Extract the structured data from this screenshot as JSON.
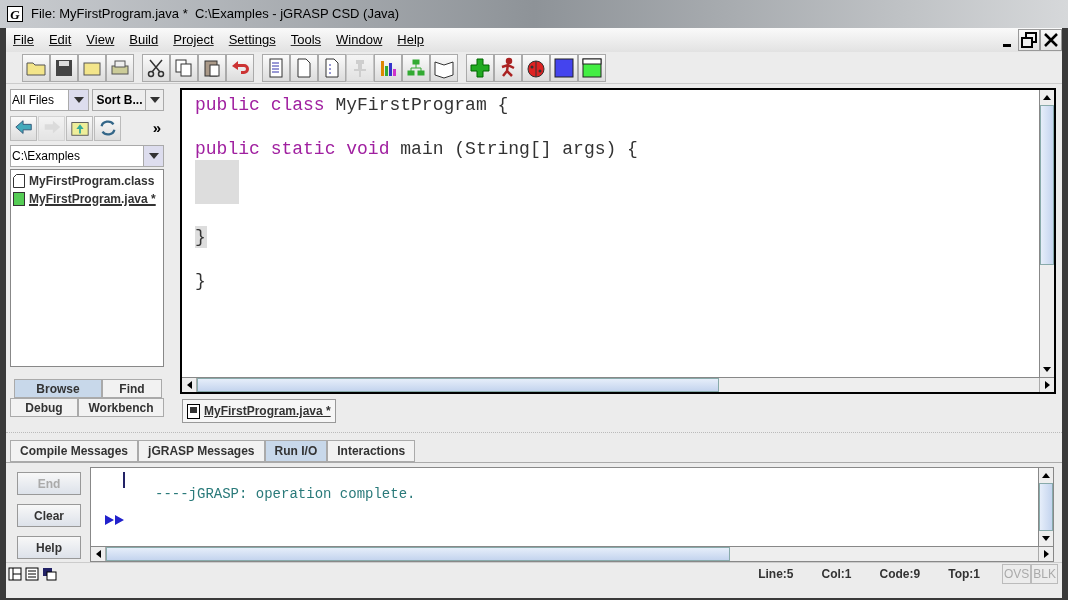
{
  "window": {
    "icon_letter": "G",
    "title": "File: MyFirstProgram.java *  C:\\Examples - jGRASP CSD (Java)"
  },
  "menu": [
    "File",
    "Edit",
    "View",
    "Build",
    "Project",
    "Settings",
    "Tools",
    "Window",
    "Help"
  ],
  "toolbar": [
    [
      {
        "kind": "open",
        "disabled": false
      },
      {
        "kind": "save",
        "disabled": false
      },
      {
        "kind": "browse",
        "disabled": false
      },
      {
        "kind": "print",
        "disabled": false
      }
    ],
    [
      {
        "kind": "cut",
        "disabled": false
      },
      {
        "kind": "copy",
        "disabled": false
      },
      {
        "kind": "paste",
        "disabled": false
      },
      {
        "kind": "undo",
        "disabled": false
      }
    ],
    [
      {
        "kind": "csd",
        "disabled": false
      },
      {
        "kind": "page",
        "disabled": false
      },
      {
        "kind": "numbers",
        "disabled": false
      },
      {
        "kind": "pin",
        "disabled": true
      },
      {
        "kind": "bars",
        "disabled": false
      },
      {
        "kind": "tree",
        "disabled": false
      },
      {
        "kind": "book",
        "disabled": false
      }
    ],
    [
      {
        "kind": "compile",
        "disabled": false
      },
      {
        "kind": "run",
        "disabled": false
      },
      {
        "kind": "debug",
        "disabled": false
      },
      {
        "kind": "square",
        "disabled": false
      },
      {
        "kind": "frame",
        "disabled": false
      }
    ]
  ],
  "browser": {
    "filter": "All Files",
    "sort": "Sort B...",
    "more": "»",
    "nav": [
      {
        "kind": "back",
        "disabled": false
      },
      {
        "kind": "forward",
        "disabled": true
      },
      {
        "kind": "up",
        "disabled": false
      },
      {
        "kind": "refresh",
        "disabled": false
      }
    ],
    "path": "C:\\Examples",
    "files": [
      {
        "name": "MyFirstProgram.class",
        "kind": "class",
        "open": false
      },
      {
        "name": "MyFirstProgram.java *",
        "kind": "java",
        "open": true
      }
    ],
    "tabs": [
      [
        {
          "label": "Browse",
          "selected": true
        },
        {
          "label": "Find",
          "selected": false
        }
      ],
      [
        {
          "label": "Debug",
          "selected": false
        },
        {
          "label": "Workbench",
          "selected": false
        }
      ]
    ]
  },
  "editor": {
    "lines": [
      {
        "highlighted": false,
        "tokens": [
          {
            "text": "public",
            "kind": "keyword"
          },
          {
            "text": "class",
            "kind": "keyword"
          },
          {
            "text": "MyFirstProgram {"
          }
        ]
      },
      {
        "highlighted": false
      },
      {
        "highlighted": false,
        "tokens": [
          {
            "text": "public",
            "kind": "keyword"
          },
          {
            "text": "static",
            "kind": "keyword"
          },
          {
            "text": "void",
            "kind": "keyword"
          },
          {
            "text": "main (String[] args) {"
          }
        ]
      },
      {
        "highlighted": true
      },
      {
        "highlighted": true
      },
      {
        "highlighted": false
      },
      {
        "highlighted": true,
        "tokens": [
          {
            "text": "}"
          }
        ]
      },
      {
        "highlighted": false
      },
      {
        "highlighted": false,
        "tokens": [
          {
            "text": "}"
          }
        ]
      }
    ],
    "file_tab": "MyFirstProgram.java *"
  },
  "messages": {
    "tabs": [
      {
        "label": "Compile Messages",
        "selected": false
      },
      {
        "label": "jGRASP Messages",
        "selected": false
      },
      {
        "label": "Run I/O",
        "selected": true
      },
      {
        "label": "Interactions",
        "selected": false
      }
    ],
    "buttons": [
      {
        "label": "End",
        "disabled": true
      },
      {
        "label": "Clear",
        "disabled": false
      },
      {
        "label": "Help",
        "disabled": false
      }
    ],
    "output": "----jGRASP: operation complete."
  },
  "status_bar": {
    "fields": [
      "Line:5",
      "Col:1",
      "Code:9",
      "Top:1"
    ],
    "modes": [
      {
        "label": "OVS",
        "on": false
      },
      {
        "label": "BLK",
        "on": false
      }
    ]
  }
}
